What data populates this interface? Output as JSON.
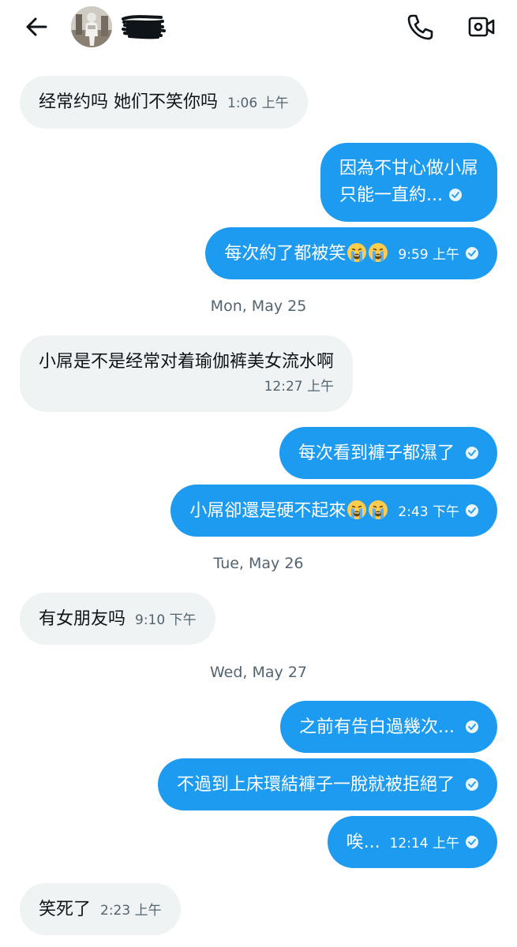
{
  "header": {
    "back_icon": "arrow-left-icon",
    "phone_icon": "phone-icon",
    "video_icon": "video-call-icon"
  },
  "colors": {
    "outgoing_bubble": "#1d9bf0",
    "incoming_bubble": "#eff3f4",
    "secondary_text": "#536471"
  },
  "messages": [
    {
      "direction": "in",
      "text": "经常约吗 她们不笑你吗",
      "time": "1:06 上午"
    },
    {
      "direction": "out",
      "lines": [
        "因為不甘心做小屌",
        "只能一直約..."
      ],
      "seen": true
    },
    {
      "direction": "out",
      "text": "每次約了都被笑",
      "emoji": [
        "loudly-crying-face",
        "loudly-crying-face"
      ],
      "time": "9:59 上午",
      "seen": true
    },
    {
      "direction": "in",
      "text": "小屌是不是经常对着瑜伽裤美女流水啊",
      "time": "12:27 上午"
    },
    {
      "direction": "out",
      "text": "每次看到褲子都濕了",
      "seen": true
    },
    {
      "direction": "out",
      "text": "小屌卻還是硬不起來",
      "emoji": [
        "loudly-crying-face",
        "loudly-crying-face"
      ],
      "time": "2:43 下午",
      "seen": true
    },
    {
      "direction": "in",
      "text": "有女朋友吗",
      "time": "9:10 下午"
    },
    {
      "direction": "out",
      "text": "之前有告白過幾次...",
      "seen": true
    },
    {
      "direction": "out",
      "text": "不過到上床環結褲子一脫就被拒絕了",
      "seen": true
    },
    {
      "direction": "out",
      "text": "唉...",
      "time": "12:14 上午",
      "seen": true
    },
    {
      "direction": "in",
      "text": "笑死了",
      "time": "2:23 上午"
    }
  ],
  "date_separators": [
    "Mon, May 25",
    "Tue, May 26",
    "Wed, May 27"
  ]
}
